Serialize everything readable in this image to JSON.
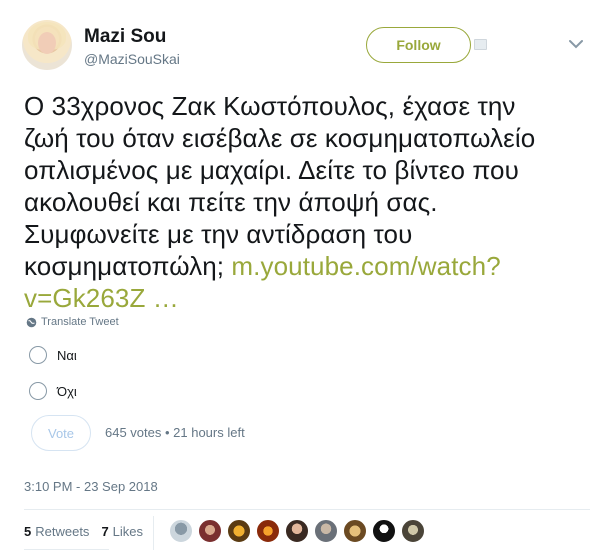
{
  "author": {
    "name": "Mazi Sou",
    "handle": "@MaziSouSkai",
    "follow_label": "Follow"
  },
  "tweet": {
    "text_lines": [
      "Ο 33χρονος Ζακ Κωστόπουλος, έχασε την",
      "ζωή του όταν εισέβαλε σε κοσμηματοπωλείο",
      "οπλισμένος με μαχαίρι. Δείτε το βίντεο που",
      "ακολουθεί και πείτε την άποψή σας.",
      "Συμφωνείτε με την αντίδραση του"
    ],
    "last_line_text": "κοσμηματοπώλη; ",
    "link_part1": "m.youtube.com/watch?",
    "link_part2": "v=Gk263Z …",
    "translate_label": "Translate Tweet"
  },
  "poll": {
    "options": [
      "Ναι",
      "Όχι"
    ],
    "vote_label": "Vote",
    "meta": "645 votes • 21 hours left"
  },
  "timestamp": "3:10 PM - 23 Sep 2018",
  "stats": {
    "retweets_count": "5",
    "retweets_label": "Retweets",
    "likes_count": "7",
    "likes_label": "Likes"
  },
  "colors": {
    "accent": "#99a83b",
    "muted": "#657786",
    "vote_text": "#a8c7e8"
  },
  "likers": [
    "liker-icon",
    "liker-icon",
    "liker-icon",
    "liker-icon",
    "liker-icon",
    "liker-icon",
    "liker-icon",
    "liker-icon",
    "liker-icon",
    "liker-icon"
  ]
}
